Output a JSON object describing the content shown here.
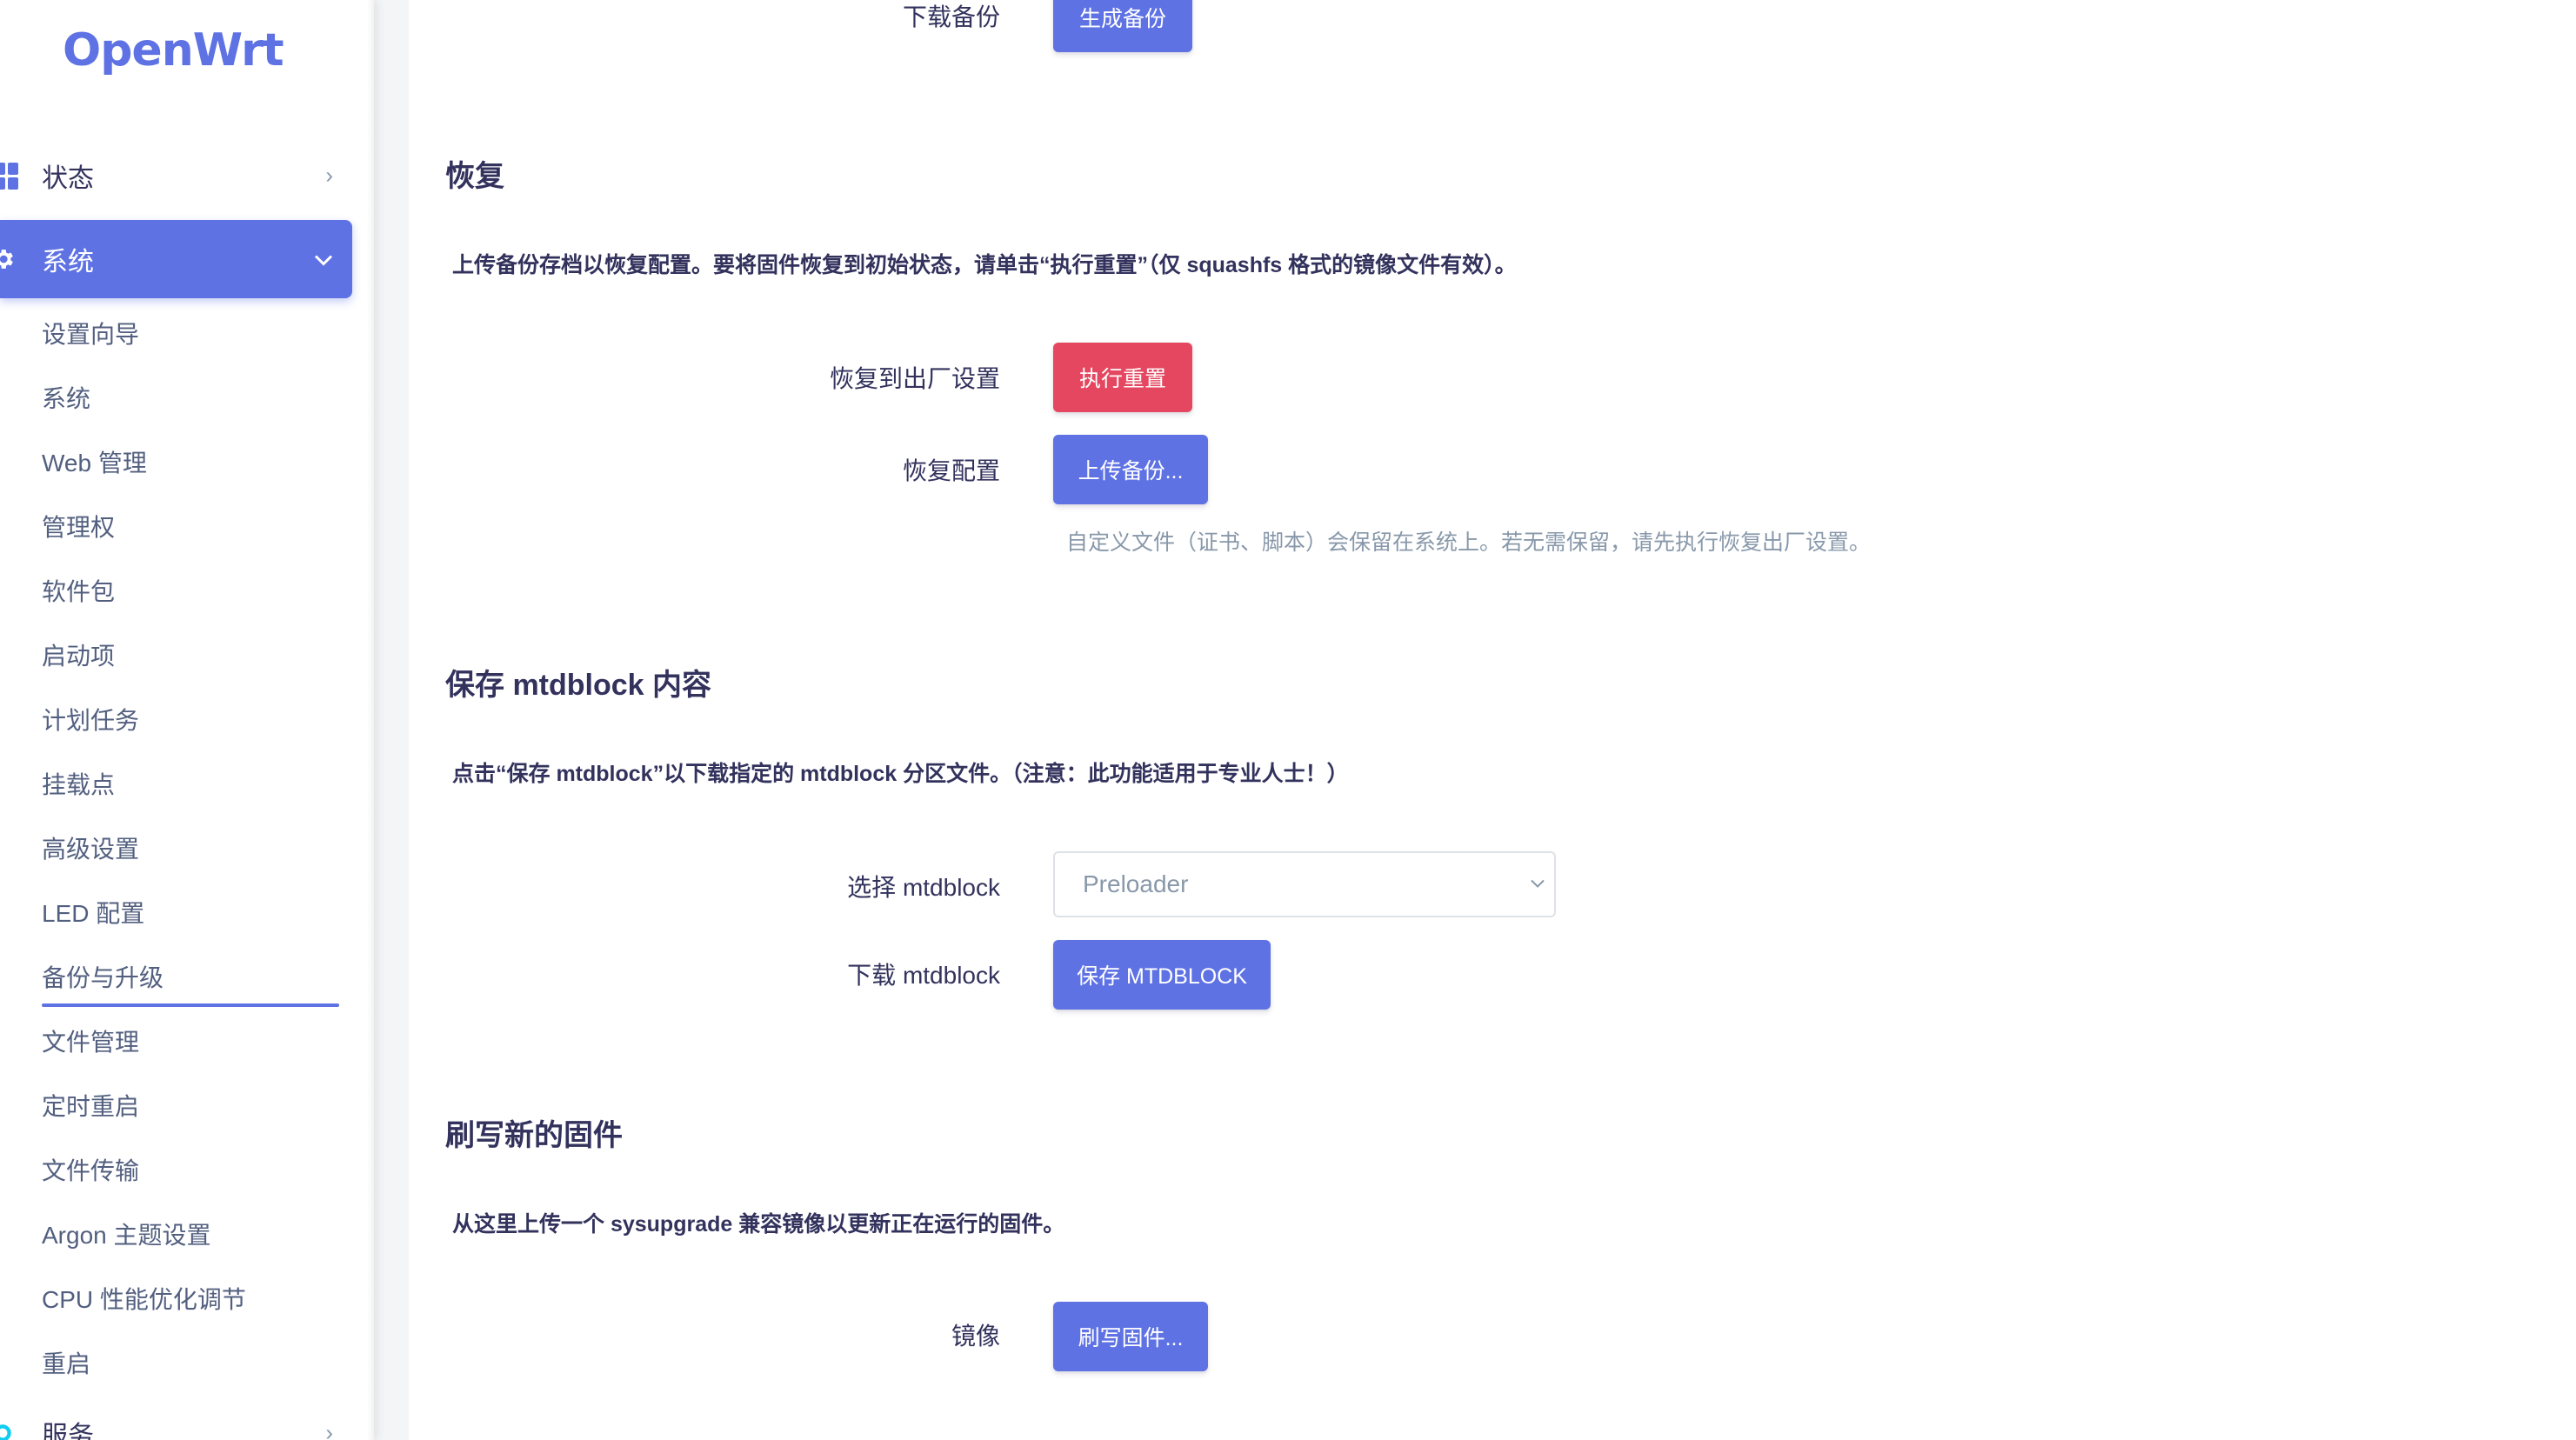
{
  "sidebar": {
    "brand": "OpenWrt",
    "status": {
      "label": "状态",
      "icon": "dashboard-icon"
    },
    "system": {
      "label": "系统",
      "icon": "gear-icon"
    },
    "services": {
      "label": "服务",
      "icon": "services-icon"
    },
    "system_items": [
      "设置向导",
      "系统",
      "Web 管理",
      "管理权",
      "软件包",
      "启动项",
      "计划任务",
      "挂载点",
      "高级设置",
      "LED 配置",
      "备份与升级",
      "文件管理",
      "定时重启",
      "文件传输",
      "Argon 主题设置",
      "CPU 性能优化调节",
      "重启"
    ],
    "active_item": "备份与升级",
    "accent_color": "#5e72e4"
  },
  "backup": {
    "download_label": "下载备份",
    "generate_button": "生成备份"
  },
  "restore": {
    "title": "恢复",
    "description": "上传备份存档以恢复配置。要将固件恢复到初始状态，请单击“执行重置”（仅 squashfs 格式的镜像文件有效）。",
    "factory_label": "恢复到出厂设置",
    "reset_button": "执行重置",
    "config_label": "恢复配置",
    "upload_button": "上传备份...",
    "hint": "自定义文件（证书、脚本）会保留在系统上。若无需保留，请先执行恢复出厂设置。",
    "danger_color": "#e4475f"
  },
  "mtdblock": {
    "title": "保存 mtdblock 内容",
    "description": "点击“保存 mtdblock”以下载指定的 mtdblock 分区文件。（注意：此功能适用于专业人士！）",
    "select_label": "选择 mtdblock",
    "select_value": "Preloader",
    "download_label": "下载 mtdblock",
    "save_button": "保存 MTDBLOCK"
  },
  "flash": {
    "title": "刷写新的固件",
    "description": "从这里上传一个 sysupgrade 兼容镜像以更新正在运行的固件。",
    "image_label": "镜像",
    "flash_button": "刷写固件..."
  }
}
